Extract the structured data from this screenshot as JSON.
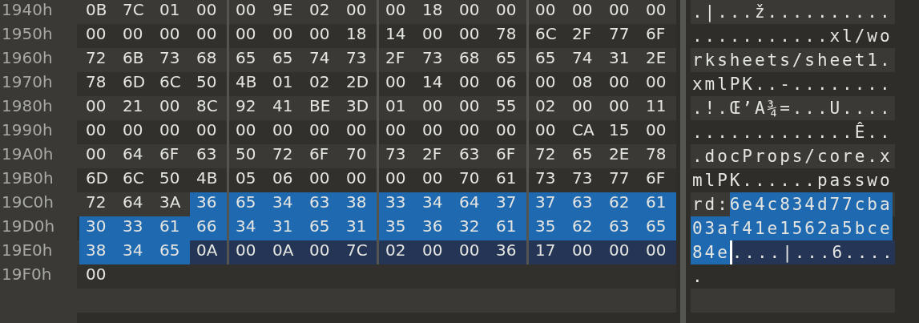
{
  "rows": [
    {
      "offset": "1940h",
      "hex": [
        {
          "selected": false,
          "marked": false,
          "bytes": [
            "0B",
            "7C",
            "01",
            "00",
            "00",
            "9E",
            "02",
            "00",
            "00",
            "18",
            "00",
            "00",
            "00",
            "00",
            "00",
            "00"
          ]
        }
      ],
      "ascii": [
        {
          "selected": false,
          "marked": false,
          "text": ".|...ž..........",
          "caret": false
        }
      ]
    },
    {
      "offset": "1950h",
      "hex": [
        {
          "selected": false,
          "marked": false,
          "bytes": [
            "00",
            "00",
            "00",
            "00",
            "00",
            "00",
            "00",
            "18",
            "14",
            "00",
            "00",
            "78",
            "6C",
            "2F",
            "77",
            "6F"
          ]
        }
      ],
      "ascii": [
        {
          "selected": false,
          "marked": false,
          "text": "...........xl/wo",
          "caret": false
        }
      ]
    },
    {
      "offset": "1960h",
      "hex": [
        {
          "selected": false,
          "marked": false,
          "bytes": [
            "72",
            "6B",
            "73",
            "68",
            "65",
            "65",
            "74",
            "73",
            "2F",
            "73",
            "68",
            "65",
            "65",
            "74",
            "31",
            "2E"
          ]
        }
      ],
      "ascii": [
        {
          "selected": false,
          "marked": false,
          "text": "rksheets/sheet1.",
          "caret": false
        }
      ]
    },
    {
      "offset": "1970h",
      "hex": [
        {
          "selected": false,
          "marked": false,
          "bytes": [
            "78",
            "6D",
            "6C",
            "50",
            "4B",
            "01",
            "02",
            "2D",
            "00",
            "14",
            "00",
            "06",
            "00",
            "08",
            "00",
            "00"
          ]
        }
      ],
      "ascii": [
        {
          "selected": false,
          "marked": false,
          "text": "xmlPK..-........",
          "caret": false
        }
      ]
    },
    {
      "offset": "1980h",
      "hex": [
        {
          "selected": false,
          "marked": false,
          "bytes": [
            "00",
            "21",
            "00",
            "8C",
            "92",
            "41",
            "BE",
            "3D",
            "01",
            "00",
            "00",
            "55",
            "02",
            "00",
            "00",
            "11"
          ]
        }
      ],
      "ascii": [
        {
          "selected": false,
          "marked": false,
          "text": ".!.Œ’A¾=...U....",
          "caret": false
        }
      ]
    },
    {
      "offset": "1990h",
      "hex": [
        {
          "selected": false,
          "marked": false,
          "bytes": [
            "00",
            "00",
            "00",
            "00",
            "00",
            "00",
            "00",
            "00",
            "00",
            "00",
            "00",
            "00",
            "00",
            "CA",
            "15",
            "00"
          ]
        }
      ],
      "ascii": [
        {
          "selected": false,
          "marked": false,
          "text": ".............Ê..",
          "caret": false
        }
      ]
    },
    {
      "offset": "19A0h",
      "hex": [
        {
          "selected": false,
          "marked": false,
          "bytes": [
            "00",
            "64",
            "6F",
            "63",
            "50",
            "72",
            "6F",
            "70",
            "73",
            "2F",
            "63",
            "6F",
            "72",
            "65",
            "2E",
            "78"
          ]
        }
      ],
      "ascii": [
        {
          "selected": false,
          "marked": false,
          "text": ".docProps/core.x",
          "caret": false
        }
      ]
    },
    {
      "offset": "19B0h",
      "hex": [
        {
          "selected": false,
          "marked": false,
          "bytes": [
            "6D",
            "6C",
            "50",
            "4B",
            "05",
            "06",
            "00",
            "00",
            "00",
            "00",
            "70",
            "61",
            "73",
            "73",
            "77",
            "6F"
          ]
        }
      ],
      "ascii": [
        {
          "selected": false,
          "marked": false,
          "text": "mlPK......passwo",
          "caret": false
        }
      ]
    },
    {
      "offset": "19C0h",
      "hex": [
        {
          "selected": false,
          "marked": false,
          "bytes": [
            "72",
            "64",
            "3A"
          ]
        },
        {
          "selected": true,
          "marked": false,
          "bytes": [
            "36",
            "65",
            "34",
            "63",
            "38",
            "33",
            "34",
            "64",
            "37",
            "37",
            "63",
            "62",
            "61"
          ]
        }
      ],
      "ascii": [
        {
          "selected": false,
          "marked": false,
          "text": "rd:",
          "caret": false
        },
        {
          "selected": true,
          "marked": false,
          "text": "6e4c834d77cba",
          "caret": false
        }
      ]
    },
    {
      "offset": "19D0h",
      "hex": [
        {
          "selected": true,
          "marked": false,
          "bytes": [
            "30",
            "33",
            "61",
            "66",
            "34",
            "31",
            "65",
            "31",
            "35",
            "36",
            "32",
            "61",
            "35",
            "62",
            "63",
            "65"
          ]
        }
      ],
      "ascii": [
        {
          "selected": true,
          "marked": false,
          "text": "03af41e1562a5bce",
          "caret": false
        }
      ]
    },
    {
      "offset": "19E0h",
      "hex": [
        {
          "selected": true,
          "marked": false,
          "bytes": [
            "38",
            "34",
            "65"
          ]
        },
        {
          "selected": false,
          "marked": true,
          "bytes": [
            "0A",
            "00",
            "0A",
            "00",
            "7C",
            "02",
            "00",
            "00",
            "36",
            "17",
            "00",
            "00",
            "00"
          ]
        }
      ],
      "ascii": [
        {
          "selected": true,
          "marked": false,
          "text": "84e",
          "caret": true
        },
        {
          "selected": false,
          "marked": true,
          "text": "....|...6....",
          "caret": false
        }
      ]
    },
    {
      "offset": "19F0h",
      "hex": [
        {
          "selected": false,
          "marked": false,
          "bytes": [
            "00"
          ]
        }
      ],
      "ascii": [
        {
          "selected": false,
          "marked": false,
          "text": ".",
          "caret": false
        }
      ]
    }
  ]
}
